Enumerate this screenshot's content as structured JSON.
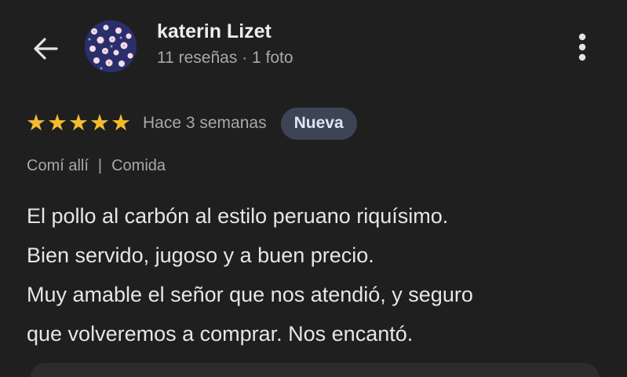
{
  "header": {
    "author_name": "katerin Lizet",
    "author_meta": "11 reseñas · 1 foto",
    "icons": {
      "back": "arrow-left-icon",
      "more": "more-vert-icon"
    }
  },
  "review": {
    "rating": 5,
    "max_rating": 5,
    "date": "Hace 3 semanas",
    "badge": "Nueva",
    "context": {
      "visit": "Comí allí",
      "separator": "|",
      "meal": "Comida"
    },
    "text_lines": [
      "El pollo al carbón al estilo peruano riquísimo.",
      "Bien servido, jugoso y a buen precio.",
      "Muy amable el señor que nos atendió, y seguro",
      "que volveremos a comprar. Nos encantó."
    ]
  },
  "colors": {
    "background": "#1f1f1f",
    "star": "#f3bc2e",
    "badge_bg": "#3c4456",
    "primary_text": "#e6e6e6",
    "secondary_text": "#a8a8a8"
  }
}
